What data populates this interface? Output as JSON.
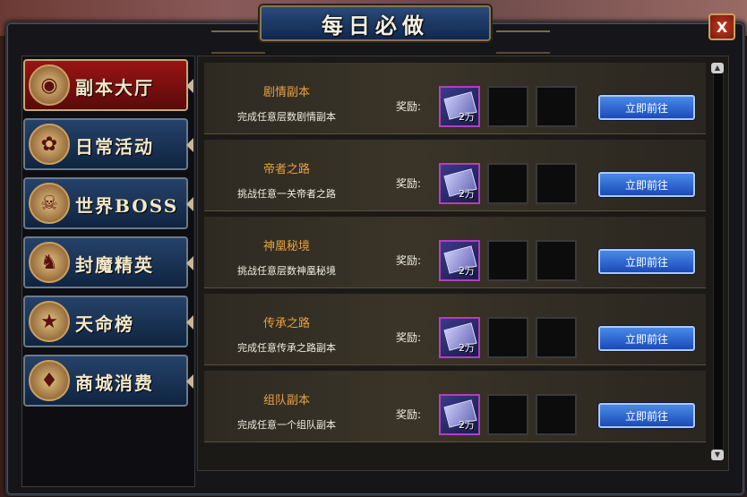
{
  "window": {
    "title": "每日必做",
    "close_label": "X"
  },
  "sidebar": {
    "items": [
      {
        "label": "副本大厅",
        "icon": "mask-icon",
        "glyph": "◉",
        "active": true
      },
      {
        "label": "日常活动",
        "icon": "flower-icon",
        "glyph": "✿",
        "active": false
      },
      {
        "label": "世界BOSS",
        "icon": "demon-icon",
        "glyph": "☠",
        "active": false
      },
      {
        "label": "封魔精英",
        "icon": "monster-icon",
        "glyph": "♞",
        "active": false
      },
      {
        "label": "天命榜",
        "icon": "banner-icon",
        "glyph": "★",
        "active": false
      },
      {
        "label": "商城消费",
        "icon": "treasure-icon",
        "glyph": "♦",
        "active": false
      }
    ]
  },
  "tasks": [
    {
      "name": "剧情副本",
      "desc": "完成任意层数剧情副本",
      "reward_label": "奖励:",
      "reward_qty": "2万",
      "button": "立即前往"
    },
    {
      "name": "帝者之路",
      "desc": "挑战任意一关帝者之路",
      "reward_label": "奖励:",
      "reward_qty": "2万",
      "button": "立即前往"
    },
    {
      "name": "神凰秘境",
      "desc": "挑战任意层数神凰秘境",
      "reward_label": "奖励:",
      "reward_qty": "2万",
      "button": "立即前往"
    },
    {
      "name": "传承之路",
      "desc": "完成任意传承之路副本",
      "reward_label": "奖励:",
      "reward_qty": "2万",
      "button": "立即前往"
    },
    {
      "name": "组队副本",
      "desc": "完成任意一个组队副本",
      "reward_label": "奖励:",
      "reward_qty": "2万",
      "button": "立即前往"
    }
  ],
  "colors": {
    "accent": "#e8a040",
    "button": "#2a5ac8",
    "active_tab": "#8a1010"
  }
}
